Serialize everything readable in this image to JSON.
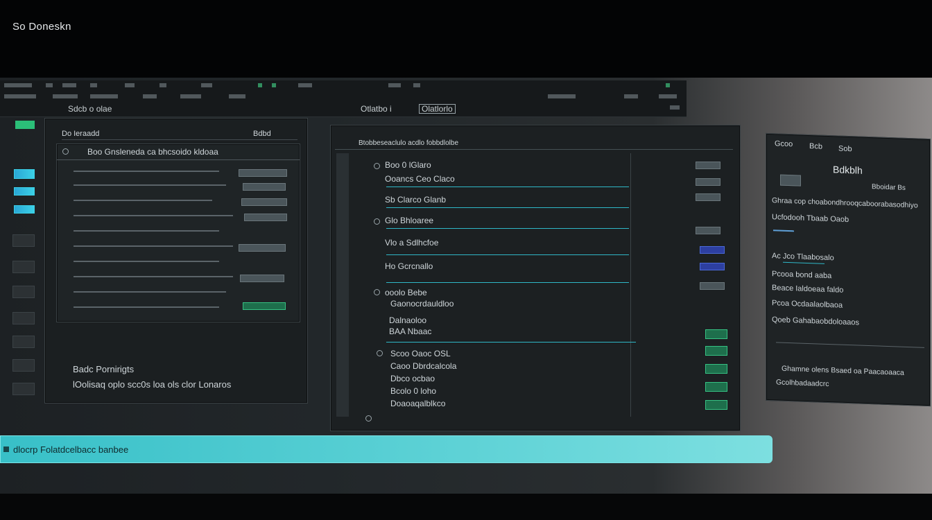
{
  "app": {
    "title": "So Doneskn"
  },
  "toolbar": {
    "label_left": "Sdcb o olae",
    "label_mid_a": "Otlatbo i",
    "label_mid_b": "Olatlorlo"
  },
  "left_panel": {
    "tabs": [
      "Do Ieraadd",
      "Bdbd"
    ],
    "header": "Boo Gnsleneda ca bhcsoido kldoaa",
    "footer_line_1": "Badc Pornirigts",
    "footer_line_2": "lOolisaq oplo scc0s loa ols clor Lonaros"
  },
  "center_panel": {
    "toolbar_label": "Btobbeseaclulo acdlo fobbdlolbe",
    "items": [
      "Boo 0 lGlaro",
      "Ooancs Ceo Claco",
      "Sb Clarco Glanb",
      "Glo Bhloaree",
      "Vlo a Sdlhcfoe",
      "Ho Gcrcnallo",
      "ooolo Bebe",
      "Gaonocrdauldloo",
      "Dalnaoloo",
      "BAA Nbaac",
      "Scoo Oaoc OSL",
      "Caoo Dbrdcalcola",
      "Dbco ocbao",
      "Bcolo 0 loho",
      "Doaoaqalblkco"
    ]
  },
  "right_panel": {
    "tabs": [
      "Gcoo",
      "Bcb",
      "Sob"
    ],
    "title": "Bdkblh",
    "subtitle": "Bboidar Bs",
    "items": [
      "Ghraa cop choabondhrooqcaboorabasodhiyo",
      "Ucfodooh Tbaab Oaob",
      "Ac Jco Tlaabosalo",
      "Pcooa bond aaba",
      "Beace Ialdoeaa faldo",
      "Pcoa Ocdaalaolbaoa",
      "Qoeb Gahabaobdoloaaos",
      "Ghamne olens Bsaed oa Paacaoaaca",
      "Gcolhbadaadcrc"
    ]
  },
  "status": {
    "text": "dlocrp Folatdcelbacc banbee"
  },
  "colors": {
    "accent": "#38c0c8",
    "green": "#36c183",
    "blue": "#3bd0e6",
    "background": "#1d2124"
  }
}
